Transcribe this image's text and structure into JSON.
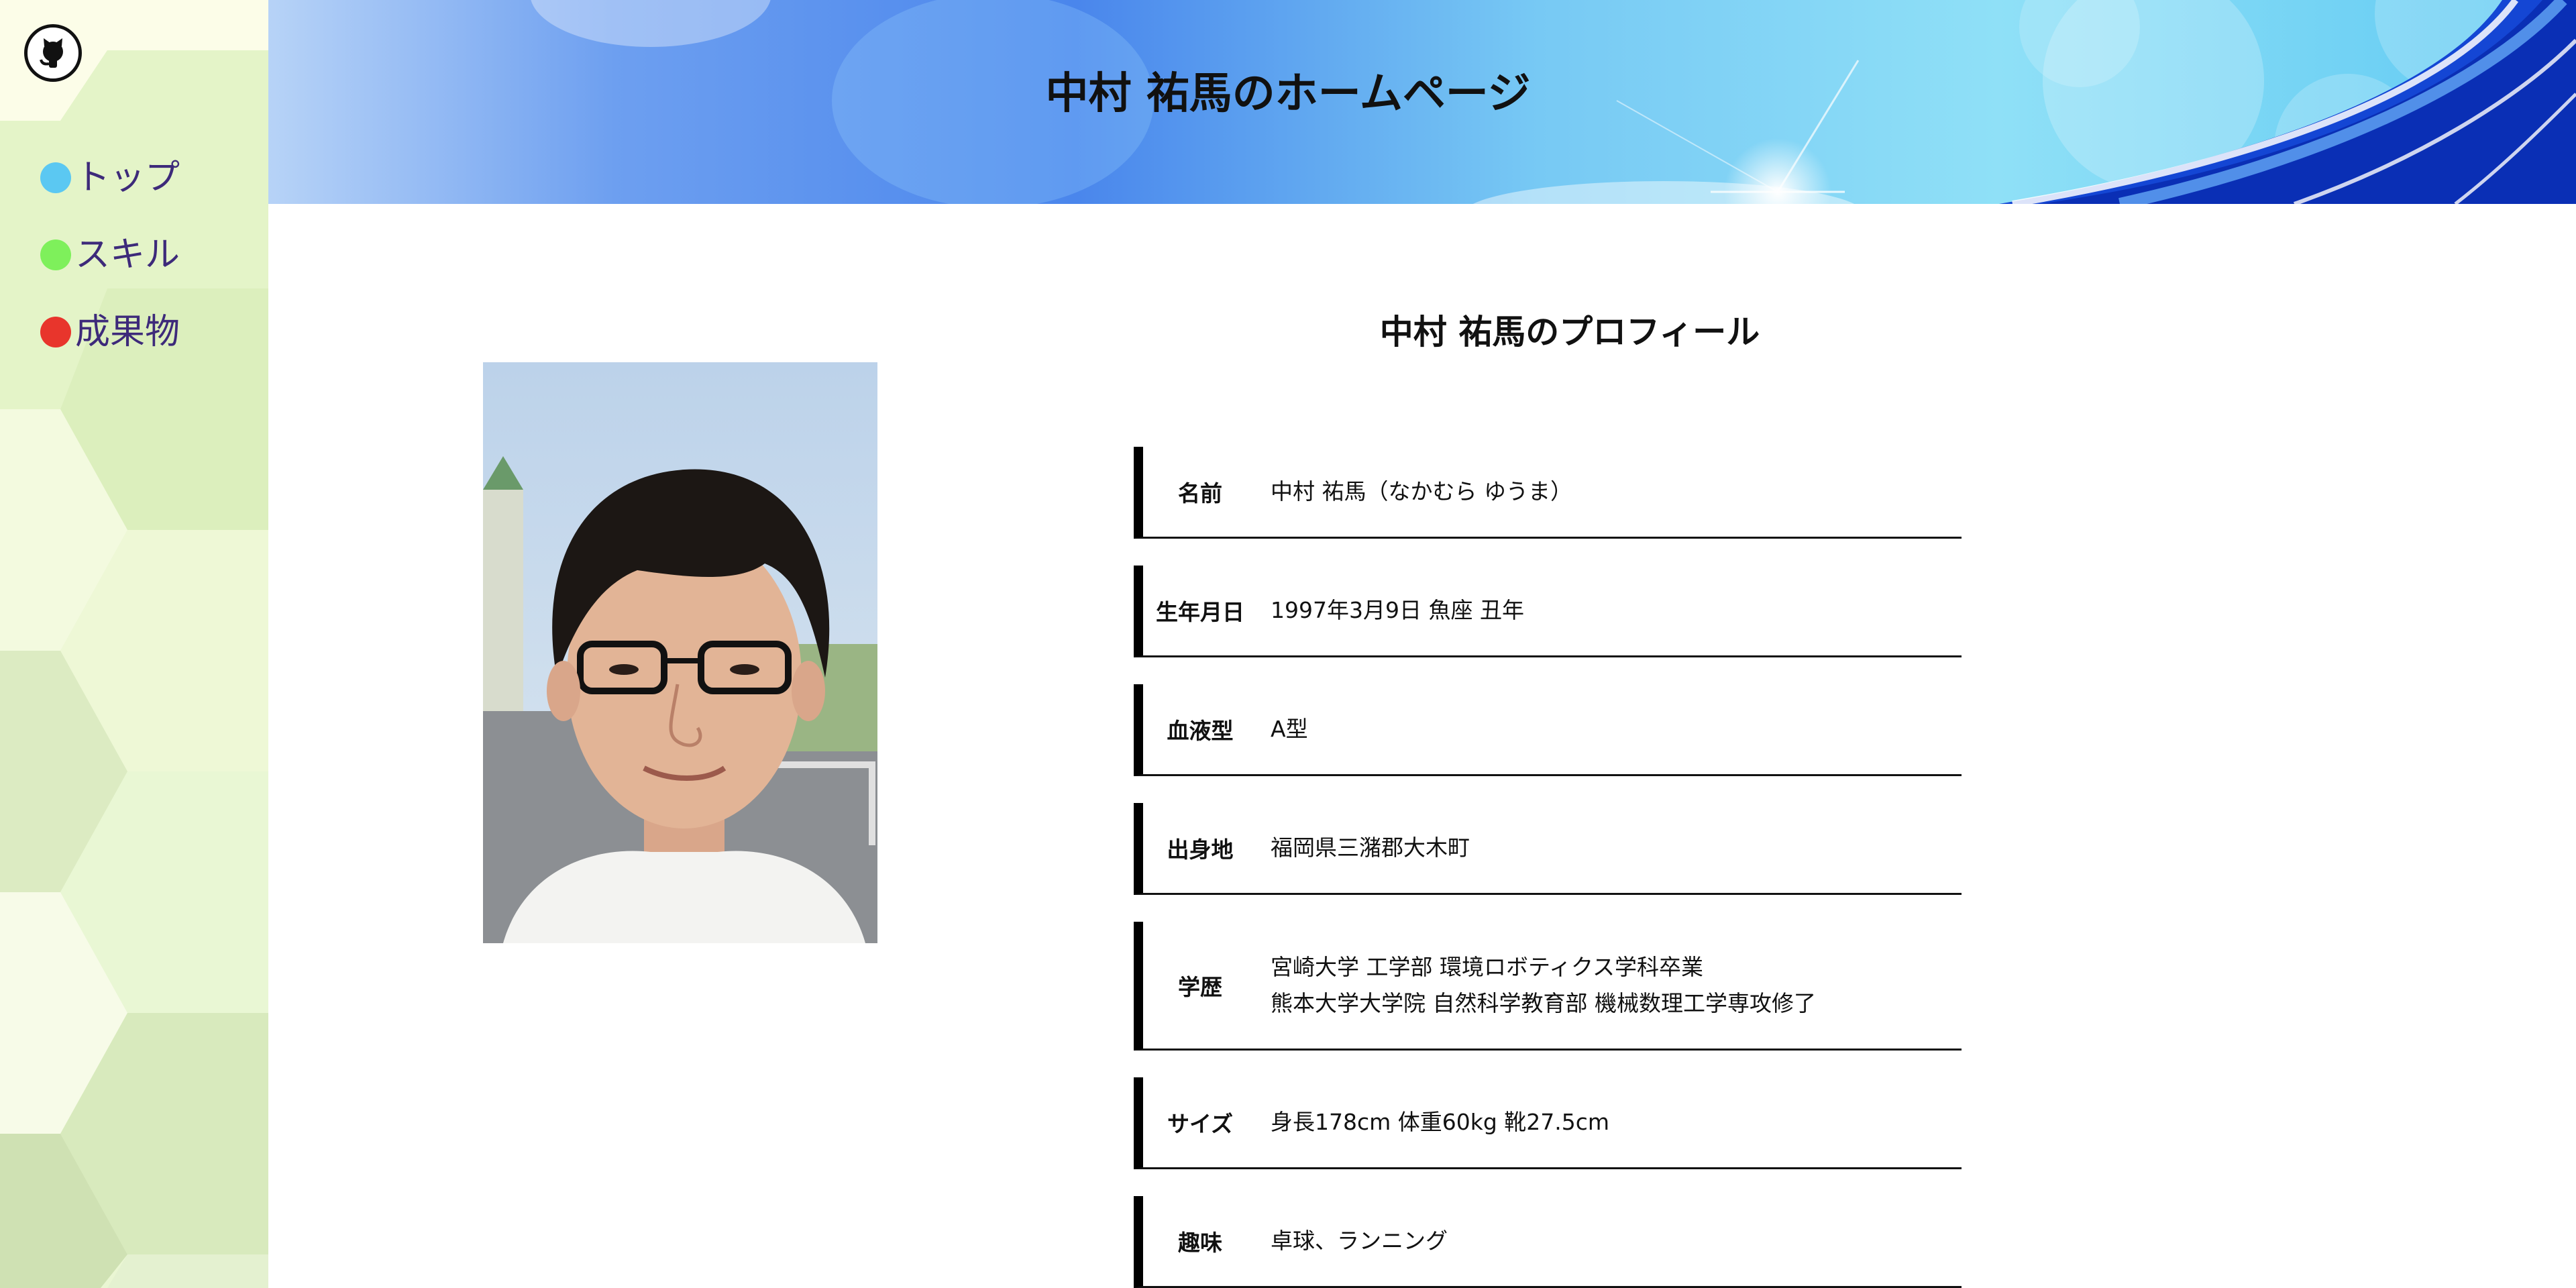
{
  "header": {
    "title": "中村 祐馬のホームページ"
  },
  "sidebar": {
    "logo_icon": "github-octocat-icon",
    "items": [
      {
        "label": "トップ",
        "dot_color": "#5bc8f2"
      },
      {
        "label": "スキル",
        "dot_color": "#7ef05b"
      },
      {
        "label": "成果物",
        "dot_color": "#e8352c"
      }
    ]
  },
  "main": {
    "profile_title": "中村 祐馬のプロフィール",
    "photo_alt": "profile-photo",
    "rows": [
      {
        "label": "名前",
        "values": [
          "中村 祐馬（なかむら ゆうま）"
        ]
      },
      {
        "label": "生年月日",
        "values": [
          "1997年3月9日 魚座 丑年"
        ]
      },
      {
        "label": "血液型",
        "values": [
          "A型"
        ]
      },
      {
        "label": "出身地",
        "values": [
          "福岡県三潴郡大木町"
        ]
      },
      {
        "label": "学歴",
        "values": [
          "宮崎大学 工学部 環境ロボティクス学科卒業",
          "熊本大学大学院 自然科学教育部 機械数理工学専攻修了"
        ]
      },
      {
        "label": "サイズ",
        "values": [
          "身長178cm 体重60kg 靴27.5cm"
        ]
      },
      {
        "label": "趣味",
        "values": [
          "卓球、ランニング"
        ]
      }
    ]
  },
  "colors": {
    "nav_text": "#3d2a7a",
    "sidebar_bg": "#eef8d9",
    "header_blue": "#3a73e6",
    "header_cyan": "#7fdcf4"
  }
}
